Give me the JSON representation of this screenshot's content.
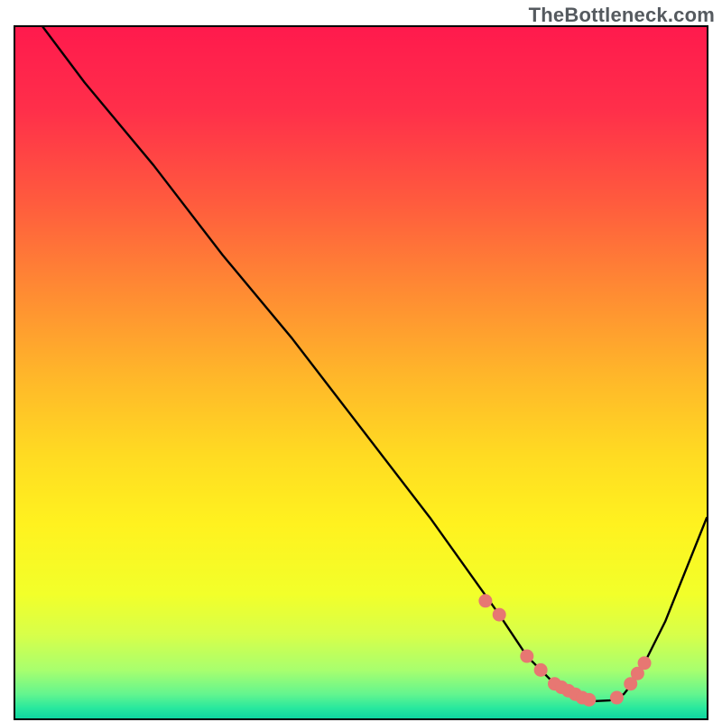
{
  "watermark": "TheBottleneck.com",
  "chart_data": {
    "type": "line",
    "title": "",
    "xlabel": "",
    "ylabel": "",
    "xlim": [
      0,
      100
    ],
    "ylim": [
      0,
      100
    ],
    "x": [
      0,
      4,
      10,
      20,
      30,
      40,
      50,
      60,
      65,
      70,
      72,
      74,
      76,
      78,
      80,
      82,
      84,
      86,
      88,
      90,
      92,
      94,
      96,
      98,
      100
    ],
    "values": [
      108,
      100,
      92,
      80,
      67,
      55,
      42,
      29,
      22,
      15,
      12,
      9,
      7,
      5,
      4,
      3,
      2.5,
      2.6,
      3.5,
      6,
      10,
      14,
      19,
      24,
      29
    ],
    "optimal_dots_x": [
      68,
      70,
      74,
      76,
      78,
      79,
      80,
      81,
      82,
      83,
      87,
      89,
      90,
      91
    ],
    "optimal_dots_y": [
      17,
      15,
      9,
      7,
      5,
      4.5,
      4,
      3.5,
      3,
      2.7,
      3,
      5,
      6.5,
      8
    ],
    "gradient": [
      {
        "offset": 0.0,
        "color": "#ff1a4d"
      },
      {
        "offset": 0.12,
        "color": "#ff2f4a"
      },
      {
        "offset": 0.25,
        "color": "#ff5a3e"
      },
      {
        "offset": 0.38,
        "color": "#ff8a33"
      },
      {
        "offset": 0.5,
        "color": "#ffb52a"
      },
      {
        "offset": 0.62,
        "color": "#ffdb22"
      },
      {
        "offset": 0.72,
        "color": "#fff21f"
      },
      {
        "offset": 0.82,
        "color": "#f2ff2a"
      },
      {
        "offset": 0.88,
        "color": "#d7ff4a"
      },
      {
        "offset": 0.93,
        "color": "#a8ff6e"
      },
      {
        "offset": 0.965,
        "color": "#63f58f"
      },
      {
        "offset": 0.985,
        "color": "#28e89e"
      },
      {
        "offset": 1.0,
        "color": "#0fd6a0"
      }
    ],
    "dot_radius_px": 7
  }
}
